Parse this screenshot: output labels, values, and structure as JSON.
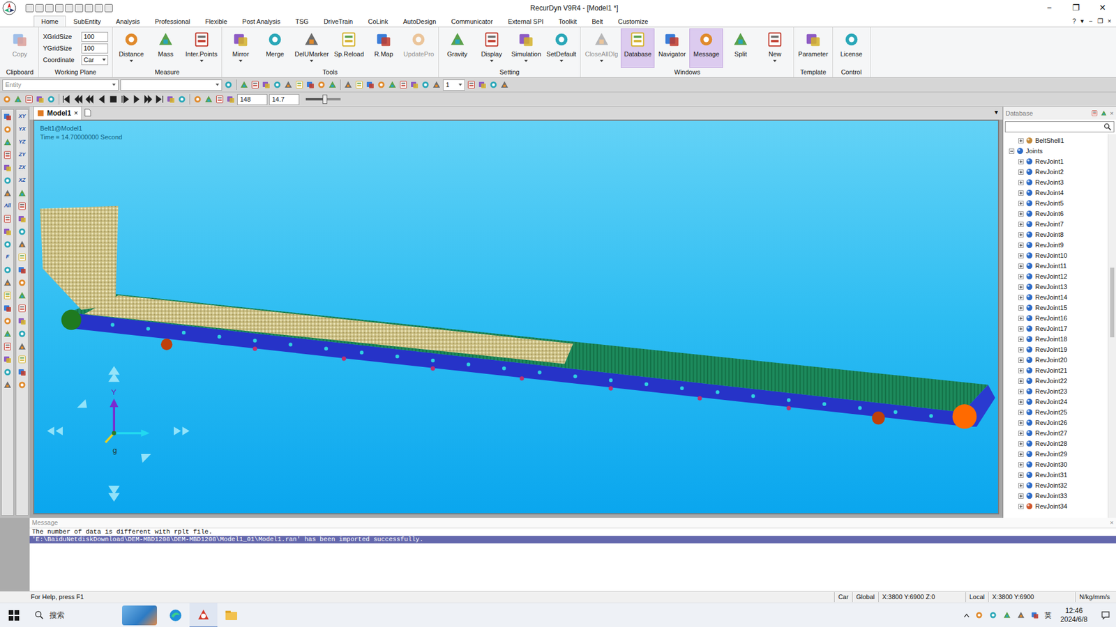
{
  "window": {
    "title": "RecurDyn V9R4 - [Model1 *]",
    "controls": [
      "−",
      "❐",
      "✕"
    ]
  },
  "ribbon_tabs": [
    {
      "label": "Home",
      "selected": true
    },
    {
      "label": "SubEntity",
      "selected": false
    },
    {
      "label": "Analysis",
      "selected": false
    },
    {
      "label": "Professional",
      "selected": false
    },
    {
      "label": "Flexible",
      "selected": false
    },
    {
      "label": "Post Analysis",
      "selected": false
    },
    {
      "label": "TSG",
      "selected": false
    },
    {
      "label": "DriveTrain",
      "selected": false
    },
    {
      "label": "CoLink",
      "selected": false
    },
    {
      "label": "AutoDesign",
      "selected": false
    },
    {
      "label": "Communicator",
      "selected": false
    },
    {
      "label": "External SPI",
      "selected": false
    },
    {
      "label": "Toolkit",
      "selected": false
    },
    {
      "label": "Belt",
      "selected": false
    },
    {
      "label": "Customize",
      "selected": false
    }
  ],
  "tab_row_right": [
    "?",
    "▾",
    "−",
    "❐",
    "×"
  ],
  "ribbon_groups": [
    {
      "label": "Clipboard",
      "fields": [],
      "buttons": [
        {
          "label": "Copy",
          "selected": false,
          "disabled": true,
          "dropdown": false
        }
      ]
    },
    {
      "label": "Working Plane",
      "fields": [
        {
          "label": "XGridSize",
          "value": "100",
          "dropdown": false
        },
        {
          "label": "YGridSize",
          "value": "100",
          "dropdown": false
        },
        {
          "label": "Coordinate",
          "value": "Car",
          "dropdown": true
        }
      ],
      "buttons": []
    },
    {
      "label": "Measure",
      "fields": [],
      "buttons": [
        {
          "label": "Distance",
          "selected": false,
          "disabled": false,
          "dropdown": true
        },
        {
          "label": "Mass",
          "selected": false,
          "disabled": false,
          "dropdown": false
        },
        {
          "label": "Inter.Points",
          "selected": false,
          "disabled": false,
          "dropdown": true
        }
      ]
    },
    {
      "label": "Tools",
      "fields": [],
      "buttons": [
        {
          "label": "Mirror",
          "selected": false,
          "disabled": false,
          "dropdown": true
        },
        {
          "label": "Merge",
          "selected": false,
          "disabled": false,
          "dropdown": false
        },
        {
          "label": "DelUMarker",
          "selected": false,
          "disabled": false,
          "dropdown": true
        },
        {
          "label": "Sp.Reload",
          "selected": false,
          "disabled": false,
          "dropdown": false
        },
        {
          "label": "R.Map",
          "selected": false,
          "disabled": false,
          "dropdown": false
        },
        {
          "label": "UpdatePro",
          "selected": false,
          "disabled": true,
          "dropdown": false
        }
      ]
    },
    {
      "label": "Setting",
      "fields": [],
      "buttons": [
        {
          "label": "Gravity",
          "selected": false,
          "disabled": false,
          "dropdown": false
        },
        {
          "label": "Display",
          "selected": false,
          "disabled": false,
          "dropdown": true
        },
        {
          "label": "Simulation",
          "selected": false,
          "disabled": false,
          "dropdown": true
        },
        {
          "label": "SetDefault",
          "selected": false,
          "disabled": false,
          "dropdown": true
        }
      ]
    },
    {
      "label": "Windows",
      "fields": [],
      "buttons": [
        {
          "label": "CloseAllDlg",
          "selected": false,
          "disabled": true,
          "dropdown": true
        },
        {
          "label": "Database",
          "selected": true,
          "disabled": false,
          "dropdown": false
        },
        {
          "label": "Navigator",
          "selected": false,
          "disabled": false,
          "dropdown": false
        },
        {
          "label": "Message",
          "selected": true,
          "disabled": false,
          "dropdown": false
        },
        {
          "label": "Split",
          "selected": false,
          "disabled": false,
          "dropdown": false
        },
        {
          "label": "New",
          "selected": false,
          "disabled": false,
          "dropdown": true
        }
      ]
    },
    {
      "label": "Template",
      "fields": [],
      "buttons": [
        {
          "label": "Parameter",
          "selected": false,
          "disabled": false,
          "dropdown": false
        }
      ]
    },
    {
      "label": "Control",
      "fields": [],
      "buttons": [
        {
          "label": "License",
          "selected": false,
          "disabled": false,
          "dropdown": false
        }
      ]
    }
  ],
  "toolbar": {
    "entity_placeholder": "Entity",
    "layer": "1",
    "frame": "148",
    "time": "14.7",
    "speed_slider": {
      "level": 0.55
    }
  },
  "left_toolbar": {
    "col1_labels": [
      "All",
      "F"
    ],
    "col2_labels": [
      "XY",
      "YX",
      "YZ",
      "ZY",
      "ZX",
      "XZ"
    ]
  },
  "document_tab": {
    "label": "Model1",
    "close": "×",
    "strip_menu": "▾"
  },
  "viewport": {
    "title": "Belt1@Model1",
    "time": "Time = 14.70000000 Second",
    "axis": {
      "y": "Y",
      "g": "g"
    }
  },
  "database": {
    "title": "Database",
    "close": "×",
    "above": [
      {
        "label": "BeltShell1",
        "expanded": false,
        "color": "#c48a3a"
      }
    ],
    "group": {
      "label": "Joints",
      "expanded": true,
      "color": "#2d6bc7",
      "children": [
        {
          "label": "RevJoint1",
          "expanded": false,
          "color": "#2d6bc7"
        },
        {
          "label": "RevJoint2",
          "expanded": false,
          "color": "#2d6bc7"
        },
        {
          "label": "RevJoint3",
          "expanded": false,
          "color": "#2d6bc7"
        },
        {
          "label": "RevJoint4",
          "expanded": false,
          "color": "#2d6bc7"
        },
        {
          "label": "RevJoint5",
          "expanded": false,
          "color": "#2d6bc7"
        },
        {
          "label": "RevJoint6",
          "expanded": false,
          "color": "#2d6bc7"
        },
        {
          "label": "RevJoint7",
          "expanded": false,
          "color": "#2d6bc7"
        },
        {
          "label": "RevJoint8",
          "expanded": false,
          "color": "#2d6bc7"
        },
        {
          "label": "RevJoint9",
          "expanded": false,
          "color": "#2d6bc7"
        },
        {
          "label": "RevJoint10",
          "expanded": false,
          "color": "#2d6bc7"
        },
        {
          "label": "RevJoint11",
          "expanded": false,
          "color": "#2d6bc7"
        },
        {
          "label": "RevJoint12",
          "expanded": false,
          "color": "#2d6bc7"
        },
        {
          "label": "RevJoint13",
          "expanded": false,
          "color": "#2d6bc7"
        },
        {
          "label": "RevJoint14",
          "expanded": false,
          "color": "#2d6bc7"
        },
        {
          "label": "RevJoint15",
          "expanded": false,
          "color": "#2d6bc7"
        },
        {
          "label": "RevJoint16",
          "expanded": false,
          "color": "#2d6bc7"
        },
        {
          "label": "RevJoint17",
          "expanded": false,
          "color": "#2d6bc7"
        },
        {
          "label": "RevJoint18",
          "expanded": false,
          "color": "#2d6bc7"
        },
        {
          "label": "RevJoint19",
          "expanded": false,
          "color": "#2d6bc7"
        },
        {
          "label": "RevJoint20",
          "expanded": false,
          "color": "#2d6bc7"
        },
        {
          "label": "RevJoint21",
          "expanded": false,
          "color": "#2d6bc7"
        },
        {
          "label": "RevJoint22",
          "expanded": false,
          "color": "#2d6bc7"
        },
        {
          "label": "RevJoint23",
          "expanded": false,
          "color": "#2d6bc7"
        },
        {
          "label": "RevJoint24",
          "expanded": false,
          "color": "#2d6bc7"
        },
        {
          "label": "RevJoint25",
          "expanded": false,
          "color": "#2d6bc7"
        },
        {
          "label": "RevJoint26",
          "expanded": false,
          "color": "#2d6bc7"
        },
        {
          "label": "RevJoint27",
          "expanded": false,
          "color": "#2d6bc7"
        },
        {
          "label": "RevJoint28",
          "expanded": false,
          "color": "#2d6bc7"
        },
        {
          "label": "RevJoint29",
          "expanded": false,
          "color": "#2d6bc7"
        },
        {
          "label": "RevJoint30",
          "expanded": false,
          "color": "#2d6bc7"
        },
        {
          "label": "RevJoint31",
          "expanded": false,
          "color": "#2d6bc7"
        },
        {
          "label": "RevJoint32",
          "expanded": false,
          "color": "#2d6bc7"
        },
        {
          "label": "RevJoint33",
          "expanded": false,
          "color": "#2d6bc7"
        },
        {
          "label": "RevJoint34",
          "expanded": false,
          "color": "#d0562b"
        }
      ]
    }
  },
  "message": {
    "title": "Message",
    "close": "×",
    "lines": [
      {
        "text": "The number of data is different with rplt file.",
        "selected": false
      },
      {
        "text": "'E:\\BaiduNetdiskDownload\\DEM-MBD1208\\DEM-MBD1208\\Model1_01\\Model1.ran' has been imported successfully.",
        "selected": true
      }
    ]
  },
  "status_bar": {
    "help": "For Help, press F1",
    "cells": [
      "Car",
      "Global",
      "X:3800 Y:6900 Z:0",
      "Local",
      "X:3800 Y:6900",
      "N/kg/mm/s"
    ]
  },
  "taskbar": {
    "search": "搜索",
    "apps": [
      {
        "selected": false
      },
      {
        "selected": true
      },
      {
        "selected": false
      }
    ],
    "tray_lang": "英",
    "time": "12:46",
    "date": "2024/6/8"
  }
}
